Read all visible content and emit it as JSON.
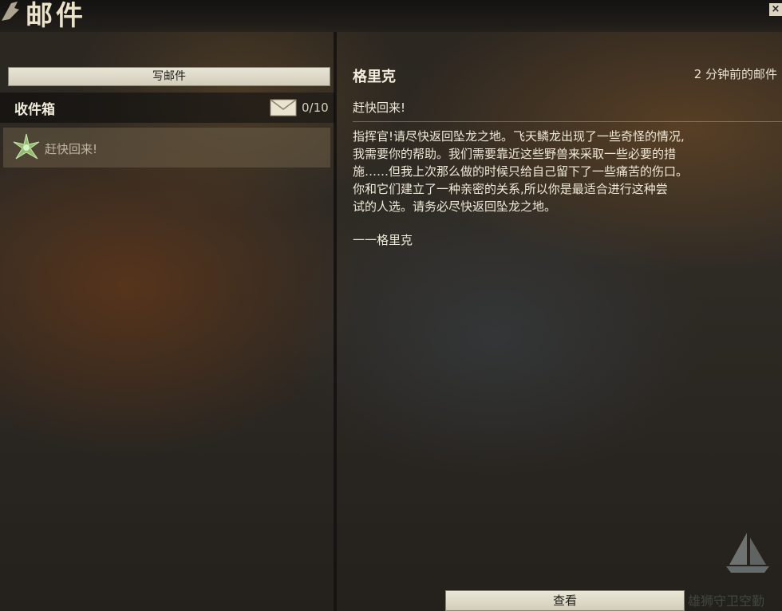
{
  "window": {
    "title": "邮件",
    "close_glyph": "×"
  },
  "inbox": {
    "compose_label": "写邮件",
    "title": "收件箱",
    "count": "0/10",
    "items": [
      {
        "subject": "赶快回来!",
        "icon": "mail-item-icon"
      }
    ]
  },
  "message": {
    "sender": "格里克",
    "timestamp": "2 分钟前的邮件",
    "subject": "赶快回来!",
    "body": "指挥官!请尽快返回坠龙之地。飞天鳞龙出现了一些奇怪的情况,\n我需要你的帮助。我们需要靠近这些野兽来采取一些必要的措\n施……但我上次那么做的时候只给自己留下了一些痛苦的伤口。\n你和它们建立了一种亲密的关系,所以你是最适合进行这种尝\n试的人选。请务必尽快返回坠龙之地。",
    "signature": "一一格里克",
    "view_label": "查看"
  },
  "background_text": {
    "line1": "雄狮守卫空勤"
  },
  "colors": {
    "button_fill": "#e0dccb",
    "text_light": "#efe9d8",
    "inbox_item_fill": "#786950"
  }
}
